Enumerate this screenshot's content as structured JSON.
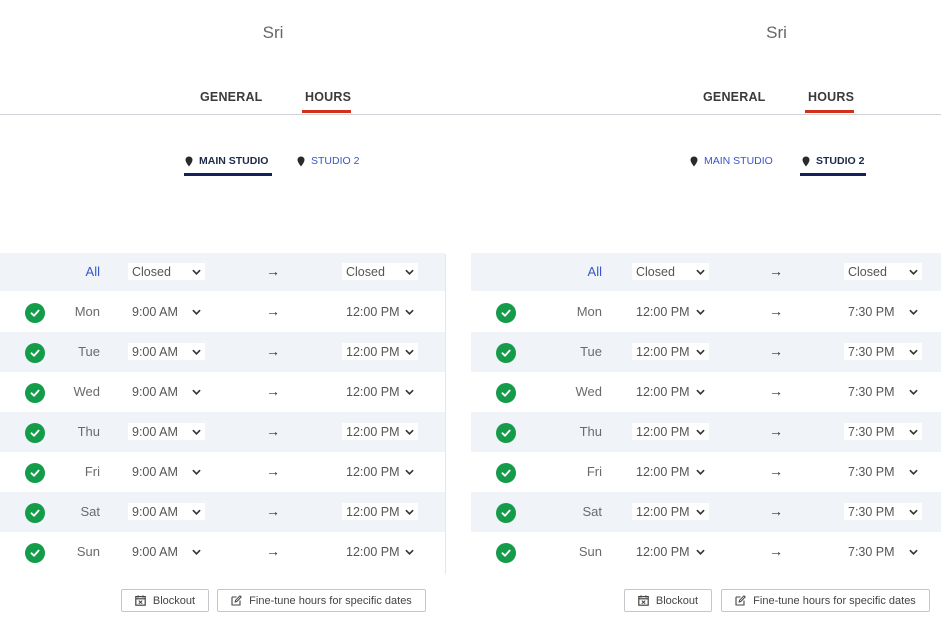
{
  "panels": [
    {
      "name": "Sri",
      "tabs": [
        {
          "label": "GENERAL"
        },
        {
          "label": "HOURS"
        }
      ],
      "active_tab": "HOURS",
      "locations": [
        {
          "label": "MAIN STUDIO"
        },
        {
          "label": "STUDIO 2"
        }
      ],
      "active_location": "MAIN STUDIO",
      "all_row": {
        "label": "All",
        "open": "Closed",
        "close": "Closed"
      },
      "days": [
        {
          "day": "Mon",
          "open": "9:00 AM",
          "close": "12:00 PM"
        },
        {
          "day": "Tue",
          "open": "9:00 AM",
          "close": "12:00 PM"
        },
        {
          "day": "Wed",
          "open": "9:00 AM",
          "close": "12:00 PM"
        },
        {
          "day": "Thu",
          "open": "9:00 AM",
          "close": "12:00 PM"
        },
        {
          "day": "Fri",
          "open": "9:00 AM",
          "close": "12:00 PM"
        },
        {
          "day": "Sat",
          "open": "9:00 AM",
          "close": "12:00 PM"
        },
        {
          "day": "Sun",
          "open": "9:00 AM",
          "close": "12:00 PM"
        }
      ],
      "arrow": "→",
      "buttons": {
        "blockout": "Blockout",
        "finetune": "Fine-tune hours for specific dates"
      }
    },
    {
      "name": "Sri",
      "tabs": [
        {
          "label": "GENERAL"
        },
        {
          "label": "HOURS"
        }
      ],
      "active_tab": "HOURS",
      "locations": [
        {
          "label": "MAIN STUDIO"
        },
        {
          "label": "STUDIO 2"
        }
      ],
      "active_location": "STUDIO 2",
      "all_row": {
        "label": "All",
        "open": "Closed",
        "close": "Closed"
      },
      "days": [
        {
          "day": "Mon",
          "open": "12:00 PM",
          "close": "7:30 PM"
        },
        {
          "day": "Tue",
          "open": "12:00 PM",
          "close": "7:30 PM"
        },
        {
          "day": "Wed",
          "open": "12:00 PM",
          "close": "7:30 PM"
        },
        {
          "day": "Thu",
          "open": "12:00 PM",
          "close": "7:30 PM"
        },
        {
          "day": "Fri",
          "open": "12:00 PM",
          "close": "7:30 PM"
        },
        {
          "day": "Sat",
          "open": "12:00 PM",
          "close": "7:30 PM"
        },
        {
          "day": "Sun",
          "open": "12:00 PM",
          "close": "7:30 PM"
        }
      ],
      "arrow": "→",
      "buttons": {
        "blockout": "Blockout",
        "finetune": "Fine-tune hours for specific dates"
      }
    }
  ],
  "colors": {
    "tab_accent": "#d0311e",
    "location_accent": "#14215a",
    "check_green": "#149c4a",
    "link_blue": "#3656c9",
    "row_shade": "#f0f4f8"
  }
}
